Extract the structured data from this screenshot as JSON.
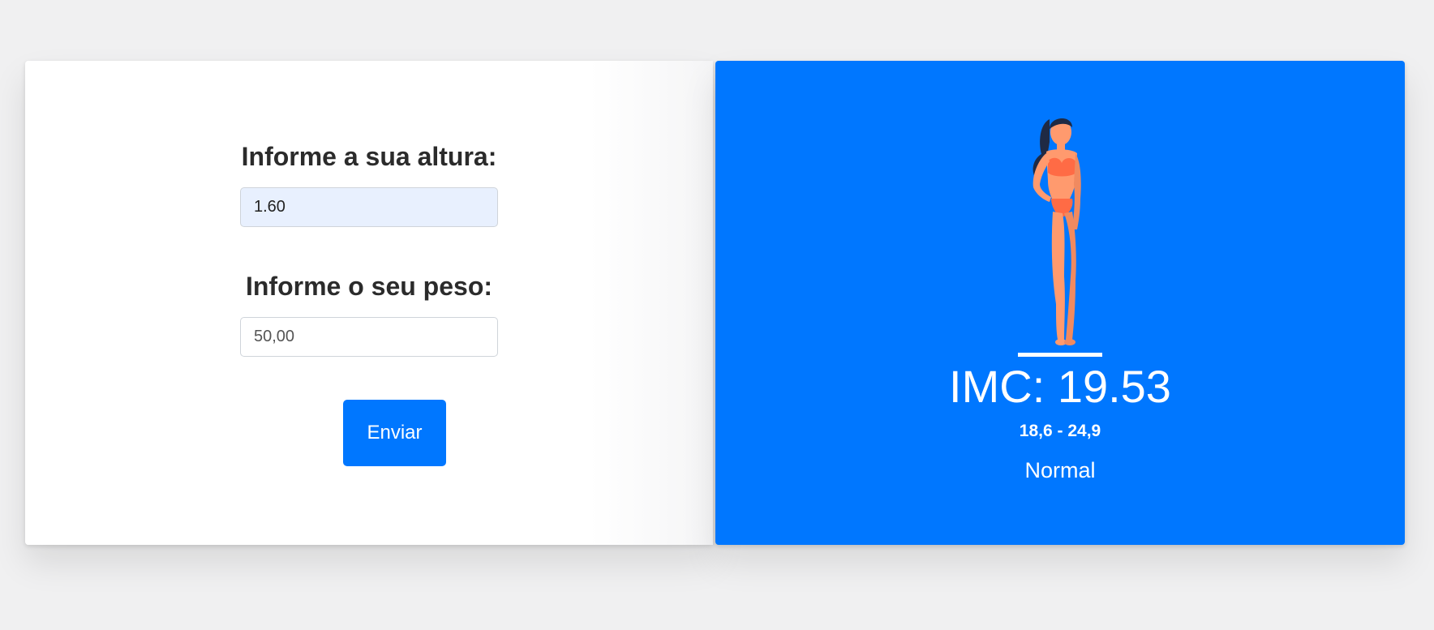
{
  "form": {
    "height_label": "Informe a sua altura:",
    "height_value": "1.60",
    "weight_label": "Informe o seu peso:",
    "weight_value": "50,00",
    "submit_label": "Enviar"
  },
  "result": {
    "imc_text": "IMC: 19.53",
    "range_text": "18,6 - 24,9",
    "classification": "Normal",
    "illustration": "woman-figure-illustration"
  },
  "colors": {
    "accent": "#0077ff",
    "background": "#f0f0f1",
    "input_autofill": "#e8f0fe",
    "figure_skin": "#ff9a6e",
    "figure_clothing": "#ff6b45",
    "figure_hair": "#1f2a44"
  }
}
